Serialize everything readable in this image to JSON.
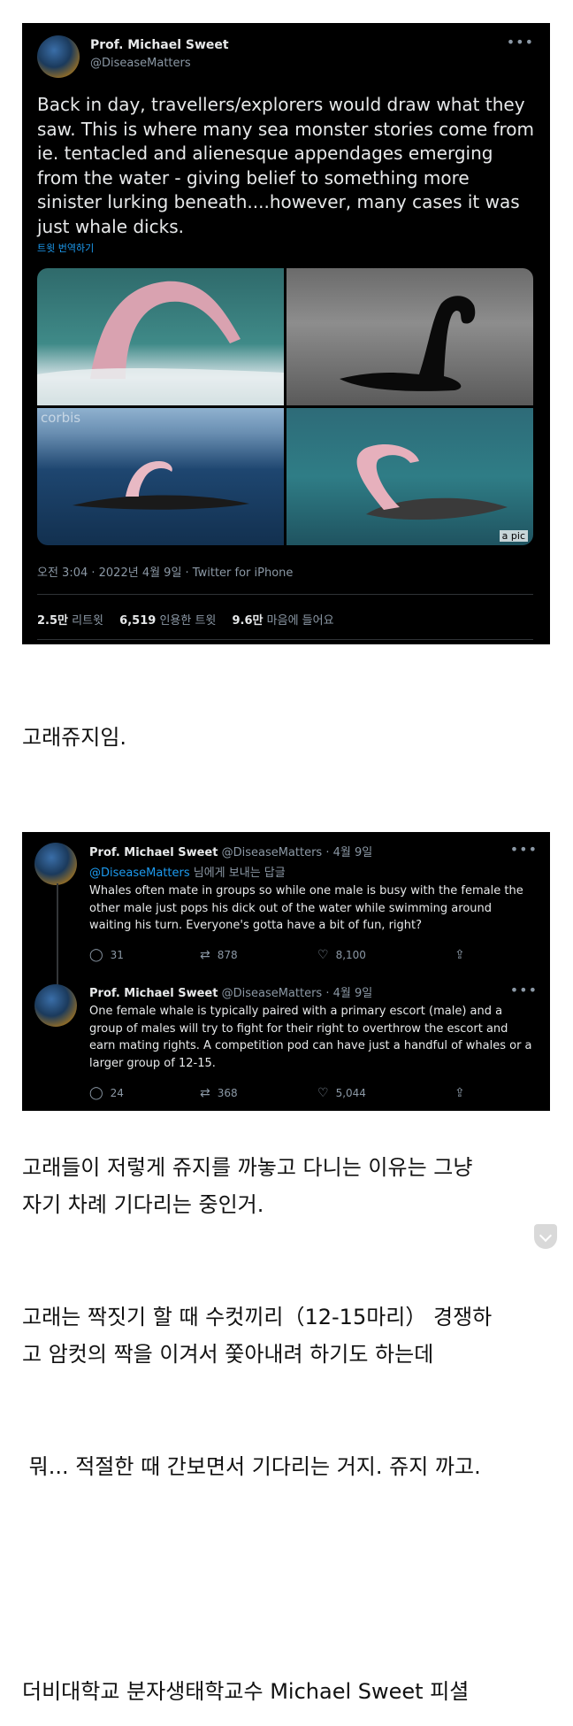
{
  "tweet": {
    "author_name": "Prof. Michael Sweet",
    "author_handle": "@DiseaseMatters",
    "more_icon": "more-dots-icon",
    "text": "Back in day, travellers/explorers would draw what they saw. This is where many sea monster stories come from ie. tentacled and alienesque appendages emerging from the water - giving belief to something more sinister lurking beneath....however, many cases it was just whale dicks.",
    "translate_label": "트윗 번역하기",
    "media": {
      "watermark_left": "corbis",
      "watermark_right": "a pic"
    },
    "timestamp": "오전 3:04 · 2022년 4월 9일 · Twitter for iPhone",
    "stats": {
      "retweets_count": "2.5만",
      "retweets_label": "리트윗",
      "quotes_count": "6,519",
      "quotes_label": "인용한 트윗",
      "likes_count": "9.6만",
      "likes_label": "마음에 들어요"
    }
  },
  "caption1": "고래쥬지임.",
  "thread": {
    "reply1": {
      "author_name": "Prof. Michael Sweet",
      "meta": "@DiseaseMatters · 4월 9일",
      "replying_mention": "@DiseaseMatters",
      "replying_suffix": " 님에게 보내는 답글",
      "text": "Whales often mate in groups so while one male is busy with the female the other male just pops his dick out of the water while swimming around waiting his turn. Everyone's gotta have a bit of fun, right?",
      "replies": "31",
      "retweets": "878",
      "likes": "8,100"
    },
    "reply2": {
      "author_name": "Prof. Michael Sweet",
      "meta": "@DiseaseMatters · 4월 9일",
      "text": "One female whale is typically paired with a primary escort (male) and a group of males will try to fight for their right to overthrow the escort and earn mating rights. A competition pod can have just a handful of whales or a larger group of 12-15.",
      "replies": "24",
      "retweets": "368",
      "likes": "5,044"
    }
  },
  "caption2_line1": "고래들이 저렇게 쥬지를 까놓고 다니는 이유는 그냥",
  "caption2_line2": "자기 차례 기다리는 중인거.",
  "caption3_line1": "고래는 짝짓기 할 때 수컷끼리（12-15마리） 경쟁하",
  "caption3_line2": "고 암컷의 짝을 이겨서 쫓아내려 하기도 하는데",
  "caption4": " 뭐... 적절한 때 간보면서 기다리는 거지. 쥬지 까고.",
  "caption5": "더비대학교 분자생태학교수 Michael Sweet 피셜"
}
